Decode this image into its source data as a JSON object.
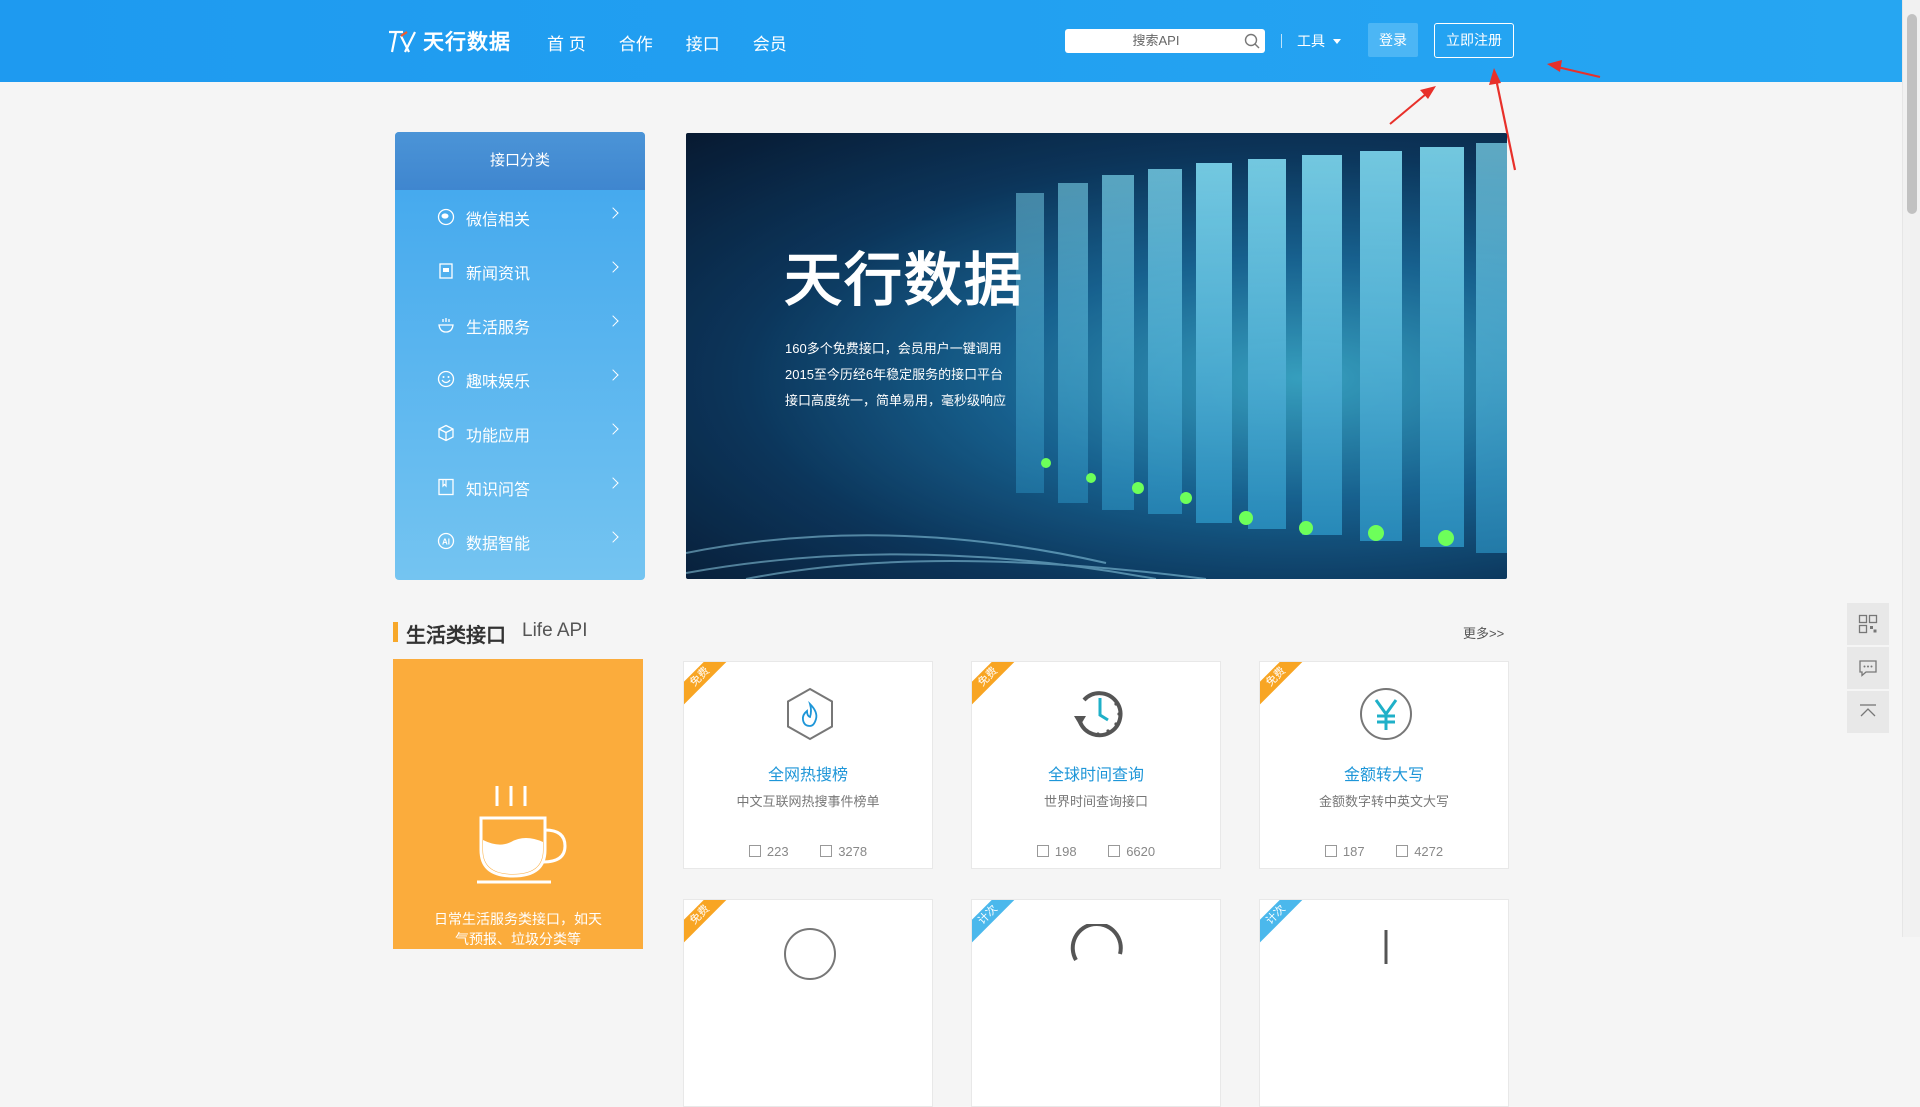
{
  "header": {
    "logo_text": "天行数据",
    "nav": [
      "首 页",
      "合作",
      "接口",
      "会员"
    ],
    "search_placeholder": "搜索API",
    "tools_label": "工具",
    "login_label": "登录",
    "register_label": "立即注册"
  },
  "categories": {
    "title": "接口分类",
    "items": [
      {
        "label": "微信相关",
        "icon": "wechat-icon"
      },
      {
        "label": "新闻资讯",
        "icon": "news-icon"
      },
      {
        "label": "生活服务",
        "icon": "life-service-icon"
      },
      {
        "label": "趣味娱乐",
        "icon": "fun-icon"
      },
      {
        "label": "功能应用",
        "icon": "cube-icon"
      },
      {
        "label": "知识问答",
        "icon": "book-icon"
      },
      {
        "label": "数据智能",
        "icon": "ai-icon"
      }
    ]
  },
  "banner": {
    "title": "天行数据",
    "lines": [
      "160多个免费接口，会员用户一键调用",
      "2015至今历经6年稳定服务的接口平台",
      "接口高度统一，简单易用，毫秒级响应"
    ]
  },
  "section": {
    "title": "生活类接口",
    "subtitle": "Life API",
    "more": "更多>>",
    "card_desc": "日常生活服务类接口，如天\n气预报、垃圾分类等"
  },
  "apis": [
    {
      "badge": "免费",
      "badge_type": "free",
      "name": "全网热搜榜",
      "desc": "中文互联网热搜事件榜单",
      "stat1": "223",
      "stat2": "3278",
      "icon": "hot-search-icon"
    },
    {
      "badge": "免费",
      "badge_type": "free",
      "name": "全球时间查询",
      "desc": "世界时间查询接口",
      "stat1": "198",
      "stat2": "6620",
      "icon": "clock-icon"
    },
    {
      "badge": "免费",
      "badge_type": "free",
      "name": "金额转大写",
      "desc": "金额数字转中英文大写",
      "stat1": "187",
      "stat2": "4272",
      "icon": "yuan-icon"
    },
    {
      "badge": "免费",
      "badge_type": "free"
    },
    {
      "badge": "计次",
      "badge_type": "paid"
    },
    {
      "badge": "计次",
      "badge_type": "paid"
    }
  ],
  "colors": {
    "header": "#229ff1",
    "accent_orange": "#f7a82a",
    "link_blue": "#1e96d8",
    "annotation_red": "#e8302a"
  }
}
